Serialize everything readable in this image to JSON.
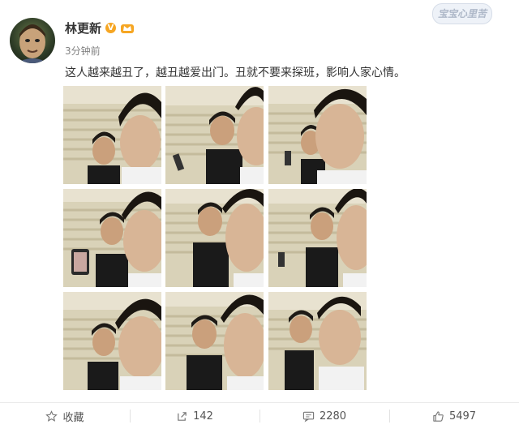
{
  "post": {
    "username": "林更新",
    "verified_badge": "V",
    "timestamp": "3分钟前",
    "text": "这人越来越丑了，越丑越爱出门。丑就不要来探班，影响人家心情。",
    "watermark": "宝宝心里苦",
    "photos_count": 9
  },
  "actions": {
    "favorite_label": "收藏",
    "share_count": "142",
    "comment_count": "2280",
    "like_count": "5497"
  },
  "colors": {
    "accent": "#f6a623",
    "text": "#333333",
    "muted": "#808080"
  }
}
